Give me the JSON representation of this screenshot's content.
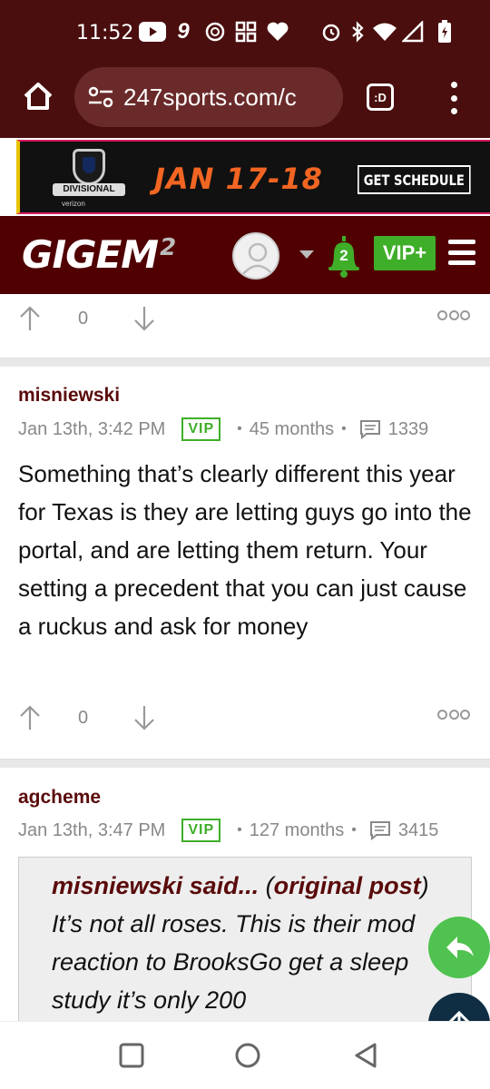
{
  "status_bar": {
    "time": "11:52",
    "icons": [
      "youtube-icon",
      "nine-icon",
      "openai-icon",
      "grid-icon",
      "heart-icon",
      "alarm-icon",
      "bluetooth-icon",
      "wifi-icon",
      "signal-icon",
      "battery-icon"
    ]
  },
  "browser": {
    "url": "247sports.com/c",
    "tab_label": ":D"
  },
  "ad": {
    "badge": "DIVISIONAL",
    "sponsor": "verizon",
    "dates": "JAN 17-18",
    "cta": "GET SCHEDULE",
    "colors": {
      "accent_orange": "#f26522",
      "accent_pink": "#d81b60",
      "accent_yellow": "#e8c200"
    }
  },
  "site_header": {
    "brand": "GIGEM",
    "brand_super": "2",
    "notifications_count": "2",
    "vip_label": "VIP+",
    "colors": {
      "maroon": "#500000",
      "green": "#3fae29"
    }
  },
  "posts": [
    {
      "votes": "0"
    },
    {
      "author": "misniewski",
      "date": "Jan 13th, 3:42 PM",
      "badge": "VIP",
      "tenure": "45 months",
      "post_count": "1339",
      "text": "Something that’s clearly different this year for Texas is they are letting guys go into the portal, and are letting them return. Your setting a precedent that you can just cause a ruckus and ask for money",
      "votes": "0"
    },
    {
      "author": "agcheme",
      "date": "Jan 13th, 3:47 PM",
      "badge": "VIP",
      "tenure": "127 months",
      "post_count": "3415",
      "quote": {
        "author_said": "misniewski said...",
        "open_paren": " (",
        "link": "original post",
        "close_paren": ")",
        "text": " It’s not all roses. This is their mod reaction to BrooksGo get a sleep study it’s only 200"
      }
    }
  ]
}
